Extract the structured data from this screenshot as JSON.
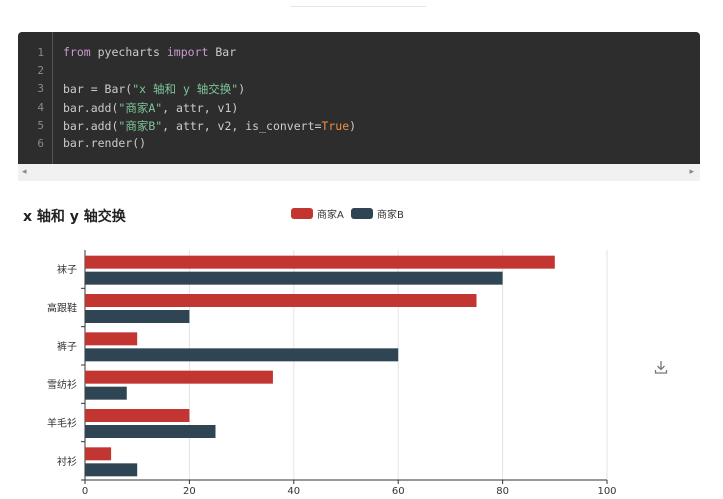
{
  "code": {
    "line_numbers": [
      "1",
      "2",
      "3",
      "4",
      "5",
      "6"
    ],
    "lines": [
      [
        {
          "t": "from",
          "c": "kw"
        },
        {
          "t": " pyecharts ",
          "c": ""
        },
        {
          "t": "import",
          "c": "kw"
        },
        {
          "t": " Bar",
          "c": ""
        }
      ],
      [],
      [
        {
          "t": "bar = Bar(",
          "c": ""
        },
        {
          "t": "\"x 轴和 y 轴交换\"",
          "c": "str"
        },
        {
          "t": ")",
          "c": ""
        }
      ],
      [
        {
          "t": "bar.add(",
          "c": ""
        },
        {
          "t": "\"商家A\"",
          "c": "str"
        },
        {
          "t": ", attr, v1)",
          "c": ""
        }
      ],
      [
        {
          "t": "bar.add(",
          "c": ""
        },
        {
          "t": "\"商家B\"",
          "c": "str"
        },
        {
          "t": ", attr, v2, is_convert=",
          "c": ""
        },
        {
          "t": "True",
          "c": "tru"
        },
        {
          "t": ")",
          "c": ""
        }
      ],
      [
        {
          "t": "bar.render()",
          "c": ""
        }
      ]
    ]
  },
  "scroll": {
    "left_arrow": "◂",
    "right_arrow": "▸"
  },
  "chart_data": {
    "type": "bar",
    "orientation": "horizontal",
    "title": "x 轴和 y 轴交换",
    "categories": [
      "衬衫",
      "羊毛衫",
      "雪纺衫",
      "裤子",
      "高跟鞋",
      "袜子"
    ],
    "series": [
      {
        "name": "商家A",
        "color": "#c23531",
        "values": [
          5,
          20,
          36,
          10,
          75,
          90
        ]
      },
      {
        "name": "商家B",
        "color": "#2f4554",
        "values": [
          10,
          25,
          8,
          60,
          20,
          80
        ]
      }
    ],
    "xlim": [
      0,
      100
    ],
    "xticks": [
      "0",
      "20",
      "40",
      "60",
      "80",
      "100"
    ],
    "grid": true,
    "legend_position": "top-center"
  },
  "icons": {
    "download": "download-icon"
  }
}
